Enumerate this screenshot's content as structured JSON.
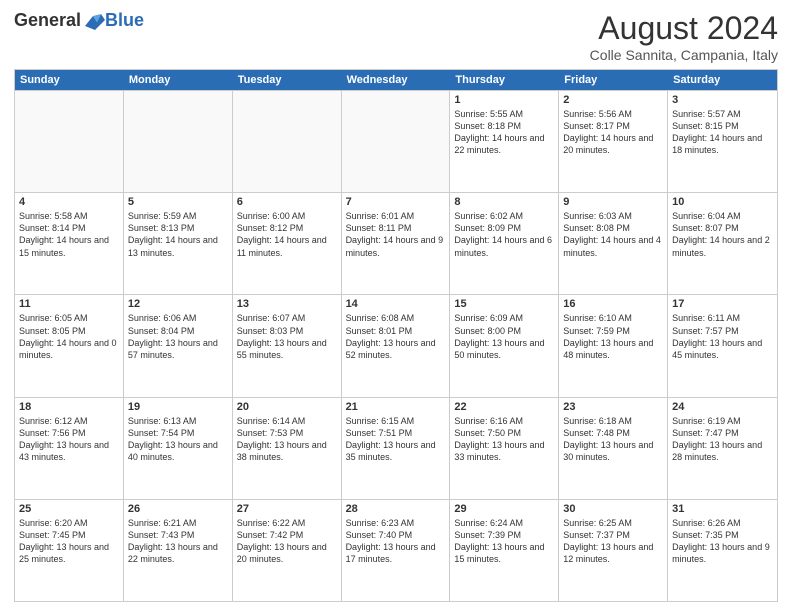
{
  "logo": {
    "general": "General",
    "blue": "Blue"
  },
  "title": "August 2024",
  "location": "Colle Sannita, Campania, Italy",
  "days": [
    "Sunday",
    "Monday",
    "Tuesday",
    "Wednesday",
    "Thursday",
    "Friday",
    "Saturday"
  ],
  "rows": [
    [
      {
        "day": "",
        "text": "",
        "empty": true
      },
      {
        "day": "",
        "text": "",
        "empty": true
      },
      {
        "day": "",
        "text": "",
        "empty": true
      },
      {
        "day": "",
        "text": "",
        "empty": true
      },
      {
        "day": "1",
        "text": "Sunrise: 5:55 AM\nSunset: 8:18 PM\nDaylight: 14 hours\nand 22 minutes."
      },
      {
        "day": "2",
        "text": "Sunrise: 5:56 AM\nSunset: 8:17 PM\nDaylight: 14 hours\nand 20 minutes."
      },
      {
        "day": "3",
        "text": "Sunrise: 5:57 AM\nSunset: 8:15 PM\nDaylight: 14 hours\nand 18 minutes."
      }
    ],
    [
      {
        "day": "4",
        "text": "Sunrise: 5:58 AM\nSunset: 8:14 PM\nDaylight: 14 hours\nand 15 minutes."
      },
      {
        "day": "5",
        "text": "Sunrise: 5:59 AM\nSunset: 8:13 PM\nDaylight: 14 hours\nand 13 minutes."
      },
      {
        "day": "6",
        "text": "Sunrise: 6:00 AM\nSunset: 8:12 PM\nDaylight: 14 hours\nand 11 minutes."
      },
      {
        "day": "7",
        "text": "Sunrise: 6:01 AM\nSunset: 8:11 PM\nDaylight: 14 hours\nand 9 minutes."
      },
      {
        "day": "8",
        "text": "Sunrise: 6:02 AM\nSunset: 8:09 PM\nDaylight: 14 hours\nand 6 minutes."
      },
      {
        "day": "9",
        "text": "Sunrise: 6:03 AM\nSunset: 8:08 PM\nDaylight: 14 hours\nand 4 minutes."
      },
      {
        "day": "10",
        "text": "Sunrise: 6:04 AM\nSunset: 8:07 PM\nDaylight: 14 hours\nand 2 minutes."
      }
    ],
    [
      {
        "day": "11",
        "text": "Sunrise: 6:05 AM\nSunset: 8:05 PM\nDaylight: 14 hours\nand 0 minutes."
      },
      {
        "day": "12",
        "text": "Sunrise: 6:06 AM\nSunset: 8:04 PM\nDaylight: 13 hours\nand 57 minutes."
      },
      {
        "day": "13",
        "text": "Sunrise: 6:07 AM\nSunset: 8:03 PM\nDaylight: 13 hours\nand 55 minutes."
      },
      {
        "day": "14",
        "text": "Sunrise: 6:08 AM\nSunset: 8:01 PM\nDaylight: 13 hours\nand 52 minutes."
      },
      {
        "day": "15",
        "text": "Sunrise: 6:09 AM\nSunset: 8:00 PM\nDaylight: 13 hours\nand 50 minutes."
      },
      {
        "day": "16",
        "text": "Sunrise: 6:10 AM\nSunset: 7:59 PM\nDaylight: 13 hours\nand 48 minutes."
      },
      {
        "day": "17",
        "text": "Sunrise: 6:11 AM\nSunset: 7:57 PM\nDaylight: 13 hours\nand 45 minutes."
      }
    ],
    [
      {
        "day": "18",
        "text": "Sunrise: 6:12 AM\nSunset: 7:56 PM\nDaylight: 13 hours\nand 43 minutes."
      },
      {
        "day": "19",
        "text": "Sunrise: 6:13 AM\nSunset: 7:54 PM\nDaylight: 13 hours\nand 40 minutes."
      },
      {
        "day": "20",
        "text": "Sunrise: 6:14 AM\nSunset: 7:53 PM\nDaylight: 13 hours\nand 38 minutes."
      },
      {
        "day": "21",
        "text": "Sunrise: 6:15 AM\nSunset: 7:51 PM\nDaylight: 13 hours\nand 35 minutes."
      },
      {
        "day": "22",
        "text": "Sunrise: 6:16 AM\nSunset: 7:50 PM\nDaylight: 13 hours\nand 33 minutes."
      },
      {
        "day": "23",
        "text": "Sunrise: 6:18 AM\nSunset: 7:48 PM\nDaylight: 13 hours\nand 30 minutes."
      },
      {
        "day": "24",
        "text": "Sunrise: 6:19 AM\nSunset: 7:47 PM\nDaylight: 13 hours\nand 28 minutes."
      }
    ],
    [
      {
        "day": "25",
        "text": "Sunrise: 6:20 AM\nSunset: 7:45 PM\nDaylight: 13 hours\nand 25 minutes."
      },
      {
        "day": "26",
        "text": "Sunrise: 6:21 AM\nSunset: 7:43 PM\nDaylight: 13 hours\nand 22 minutes."
      },
      {
        "day": "27",
        "text": "Sunrise: 6:22 AM\nSunset: 7:42 PM\nDaylight: 13 hours\nand 20 minutes."
      },
      {
        "day": "28",
        "text": "Sunrise: 6:23 AM\nSunset: 7:40 PM\nDaylight: 13 hours\nand 17 minutes."
      },
      {
        "day": "29",
        "text": "Sunrise: 6:24 AM\nSunset: 7:39 PM\nDaylight: 13 hours\nand 15 minutes."
      },
      {
        "day": "30",
        "text": "Sunrise: 6:25 AM\nSunset: 7:37 PM\nDaylight: 13 hours\nand 12 minutes."
      },
      {
        "day": "31",
        "text": "Sunrise: 6:26 AM\nSunset: 7:35 PM\nDaylight: 13 hours\nand 9 minutes."
      }
    ]
  ]
}
